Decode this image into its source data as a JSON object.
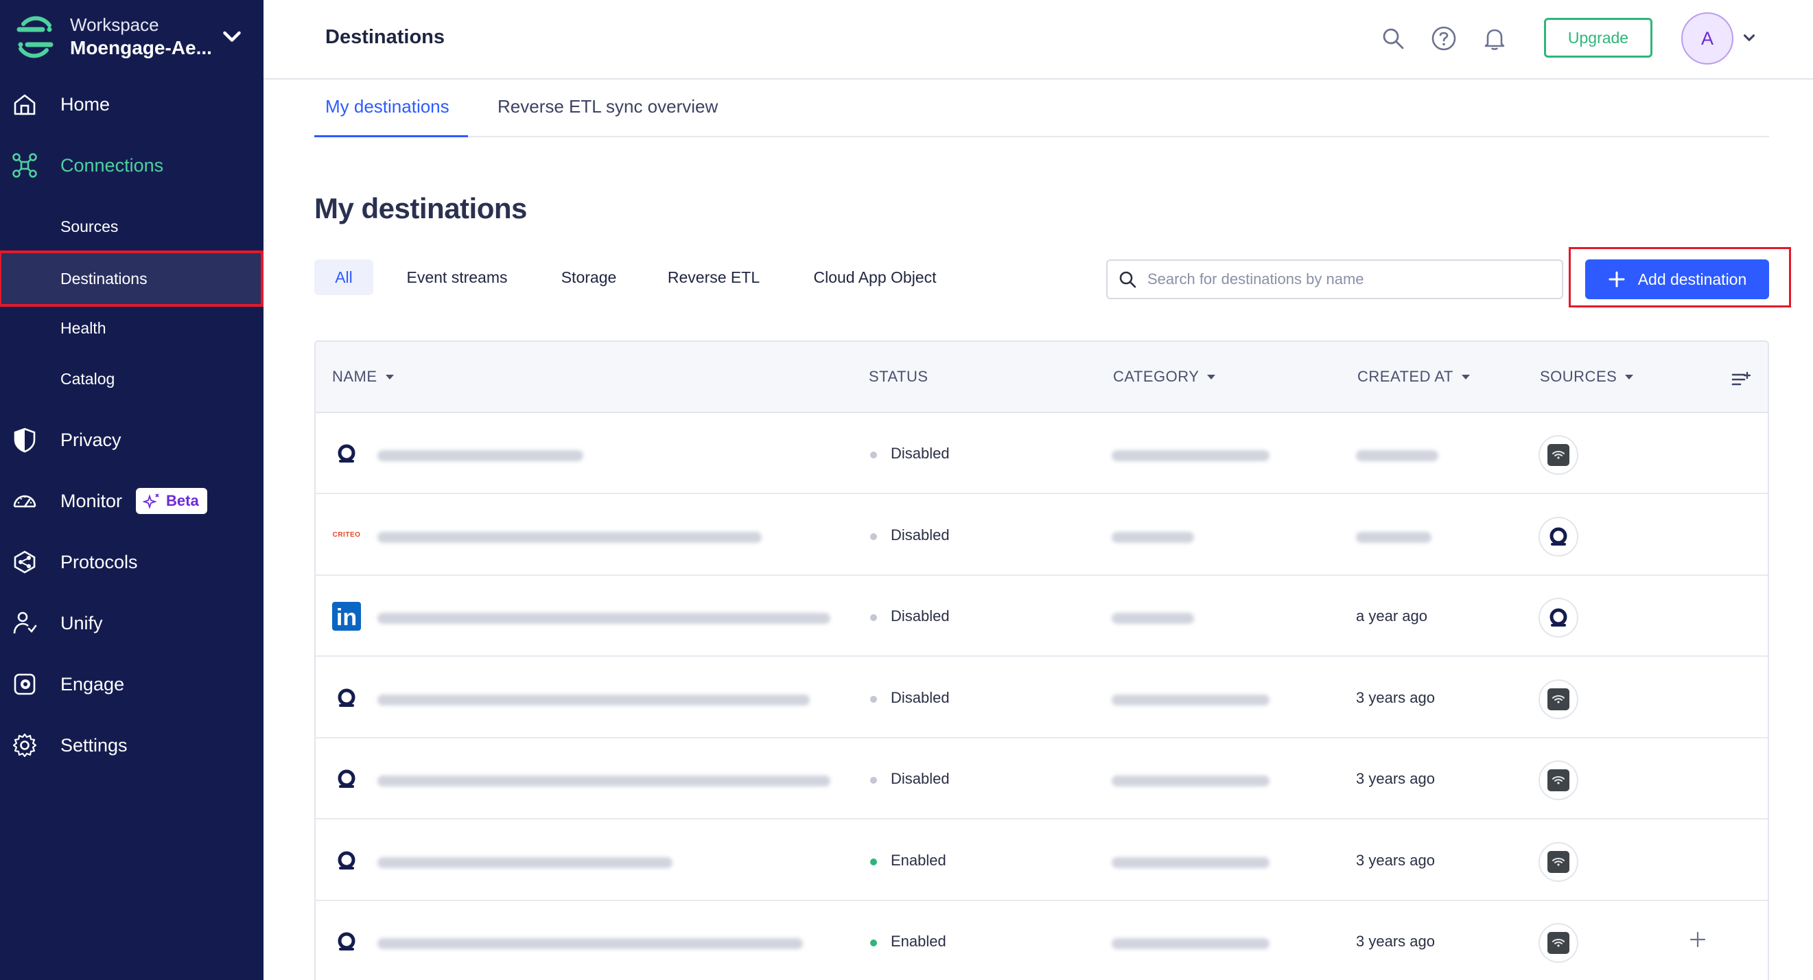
{
  "sidebar": {
    "workspace_label": "Workspace",
    "workspace_name": "Moengage-Ae...",
    "nav": {
      "home": "Home",
      "connections": "Connections",
      "sources": "Sources",
      "destinations": "Destinations",
      "health": "Health",
      "catalog": "Catalog",
      "privacy": "Privacy",
      "monitor": "Monitor",
      "monitor_badge": "Beta",
      "protocols": "Protocols",
      "unify": "Unify",
      "engage": "Engage",
      "settings": "Settings"
    },
    "accent_color": "#4fd19f",
    "bg_color": "#141c4f"
  },
  "header": {
    "title": "Destinations",
    "upgrade_label": "Upgrade",
    "avatar_initial": "A"
  },
  "tabs": {
    "my_destinations": "My destinations",
    "reverse_etl_overview": "Reverse ETL sync overview"
  },
  "main": {
    "title": "My destinations",
    "filters": {
      "all": "All",
      "event_streams": "Event streams",
      "storage": "Storage",
      "reverse_etl": "Reverse ETL",
      "cloud_app_object": "Cloud App Object"
    },
    "search_placeholder": "Search for destinations by name",
    "add_destination_label": "Add destination",
    "primary_color": "#2d5bff"
  },
  "table": {
    "columns": {
      "name": "NAME",
      "status": "STATUS",
      "category": "CATEGORY",
      "created_at": "CREATED AT",
      "sources": "SOURCES"
    },
    "rows": [
      {
        "logo": "moengage-logo",
        "status": "Disabled",
        "created": "",
        "source": "http-api-icon"
      },
      {
        "logo": "criteo-logo",
        "logo_text": "CRITEO",
        "status": "Disabled",
        "created": "",
        "source": "moengage-icon"
      },
      {
        "logo": "linkedin-logo",
        "logo_text": "in",
        "status": "Disabled",
        "created": "a year ago",
        "source": "moengage-icon"
      },
      {
        "logo": "moengage-logo",
        "status": "Disabled",
        "created": "3 years ago",
        "source": "http-api-icon"
      },
      {
        "logo": "moengage-logo",
        "status": "Disabled",
        "created": "3 years ago",
        "source": "http-api-icon"
      },
      {
        "logo": "moengage-logo",
        "status": "Enabled",
        "created": "3 years ago",
        "source": "http-api-icon"
      },
      {
        "logo": "moengage-logo",
        "status": "Enabled",
        "created": "3 years ago",
        "source": "http-api-icon"
      }
    ],
    "status_colors": {
      "Disabled": "#c4c8d4",
      "Enabled": "#2fb57a"
    }
  }
}
